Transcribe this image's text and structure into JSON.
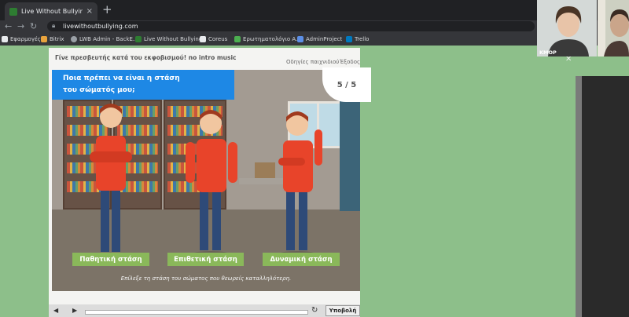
{
  "browser": {
    "tab_title": "Live Without Bullying",
    "new_tab_icon": "+",
    "close_tab_icon": "×",
    "url": "livewithoutbullying.com",
    "bookmarks": [
      "Εφαρμογές",
      "Bitrix",
      "LWB Admin - BackE...",
      "Live Without Bullying",
      "Coreus",
      "Ερωτηματολόγιο Α...",
      "AdminProject",
      "Trello"
    ]
  },
  "game": {
    "header_title": "Γίνε πρεσβευτής κατά του εκφοβισμού! no intro music",
    "guide_link": "Οδηγίες παιχνιδιού",
    "exit_link": "Έξοδος",
    "question_line1": "Ποια πρέπει να είναι η στάση",
    "question_line2": "του σώματός μου;",
    "counter": "5 / 5",
    "options": [
      "Παθητική στάση",
      "Επιθετική στάση",
      "Δυναμική στάση"
    ],
    "instruction": "Επίλεξε τη στάση του σώματος που θεωρείς καταλληλότερη.",
    "submit_label": "Υποβολή"
  },
  "video_call": {
    "participant_label": "KMOP"
  },
  "colors": {
    "question_bg": "#1e88e5",
    "option_bg": "#8ab85a",
    "page_bg": "#8dbf8a",
    "shirt": "#e8442a"
  }
}
